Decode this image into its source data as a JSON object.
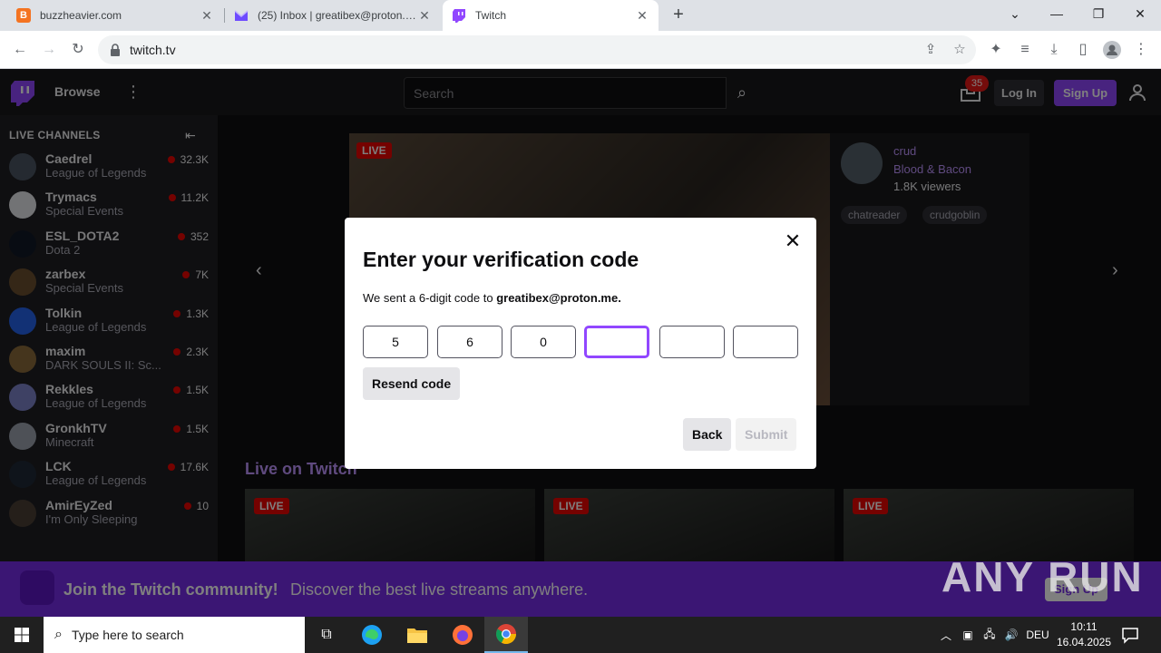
{
  "browser": {
    "tabs": [
      {
        "title": "buzzheavier.com",
        "icon": "B"
      },
      {
        "title": "(25) Inbox | greatibex@proton.me",
        "icon": "proton-icon"
      },
      {
        "title": "Twitch",
        "icon": "twitch-icon"
      }
    ],
    "url": "twitch.tv"
  },
  "twitch": {
    "nav": {
      "browse": "Browse",
      "search_placeholder": "Search",
      "inbox_badge": "35",
      "login": "Log In",
      "signup": "Sign Up"
    },
    "sidebar": {
      "heading": "LIVE CHANNELS",
      "channels": [
        {
          "name": "Caedrel",
          "game": "League of Legends",
          "viewers": "32.3K",
          "color": "#4b5563"
        },
        {
          "name": "Trymacs",
          "game": "Special Events",
          "viewers": "11.2K",
          "color": "#e5e7eb"
        },
        {
          "name": "ESL_DOTA2",
          "game": "Dota 2",
          "viewers": "352",
          "color": "#111827"
        },
        {
          "name": "zarbex",
          "game": "Special Events",
          "viewers": "7K",
          "color": "#6b4f2f"
        },
        {
          "name": "Tolkin",
          "game": "League of Legends",
          "viewers": "1.3K",
          "color": "#2563eb"
        },
        {
          "name": "maxim",
          "game": "DARK SOULS II: Sc...",
          "viewers": "2.3K",
          "color": "#8a6a3a"
        },
        {
          "name": "Rekkles",
          "game": "League of Legends",
          "viewers": "1.5K",
          "color": "#7c83c8"
        },
        {
          "name": "GronkhTV",
          "game": "Minecraft",
          "viewers": "1.5K",
          "color": "#9ca3af"
        },
        {
          "name": "LCK",
          "game": "League of Legends",
          "viewers": "17.6K",
          "color": "#1f2937"
        },
        {
          "name": "AmirEyZed",
          "game": "I'm Only Sleeping",
          "viewers": "10",
          "color": "#4a3f35"
        }
      ]
    },
    "featured": {
      "live": "LIVE",
      "channel": "crud",
      "game": "Blood & Bacon",
      "viewers": "1.8K viewers",
      "tags": [
        "chatreader",
        "crudgoblin"
      ]
    },
    "live_heading": "Live on Twitch",
    "live_badge": "LIVE",
    "banner": {
      "title": "Join the Twitch community!",
      "text": "Discover the best live streams anywhere.",
      "signup": "Sign Up"
    },
    "watermark": "ANY RUN"
  },
  "modal": {
    "title": "Enter your verification code",
    "subtitle_prefix": "We sent a 6-digit code to ",
    "email": "greatibex@proton.me.",
    "code": [
      "5",
      "6",
      "0",
      "",
      "",
      ""
    ],
    "resend": "Resend code",
    "back": "Back",
    "submit": "Submit"
  },
  "taskbar": {
    "search_placeholder": "Type here to search",
    "language": "DEU",
    "time": "10:11",
    "date": "16.04.2025"
  }
}
